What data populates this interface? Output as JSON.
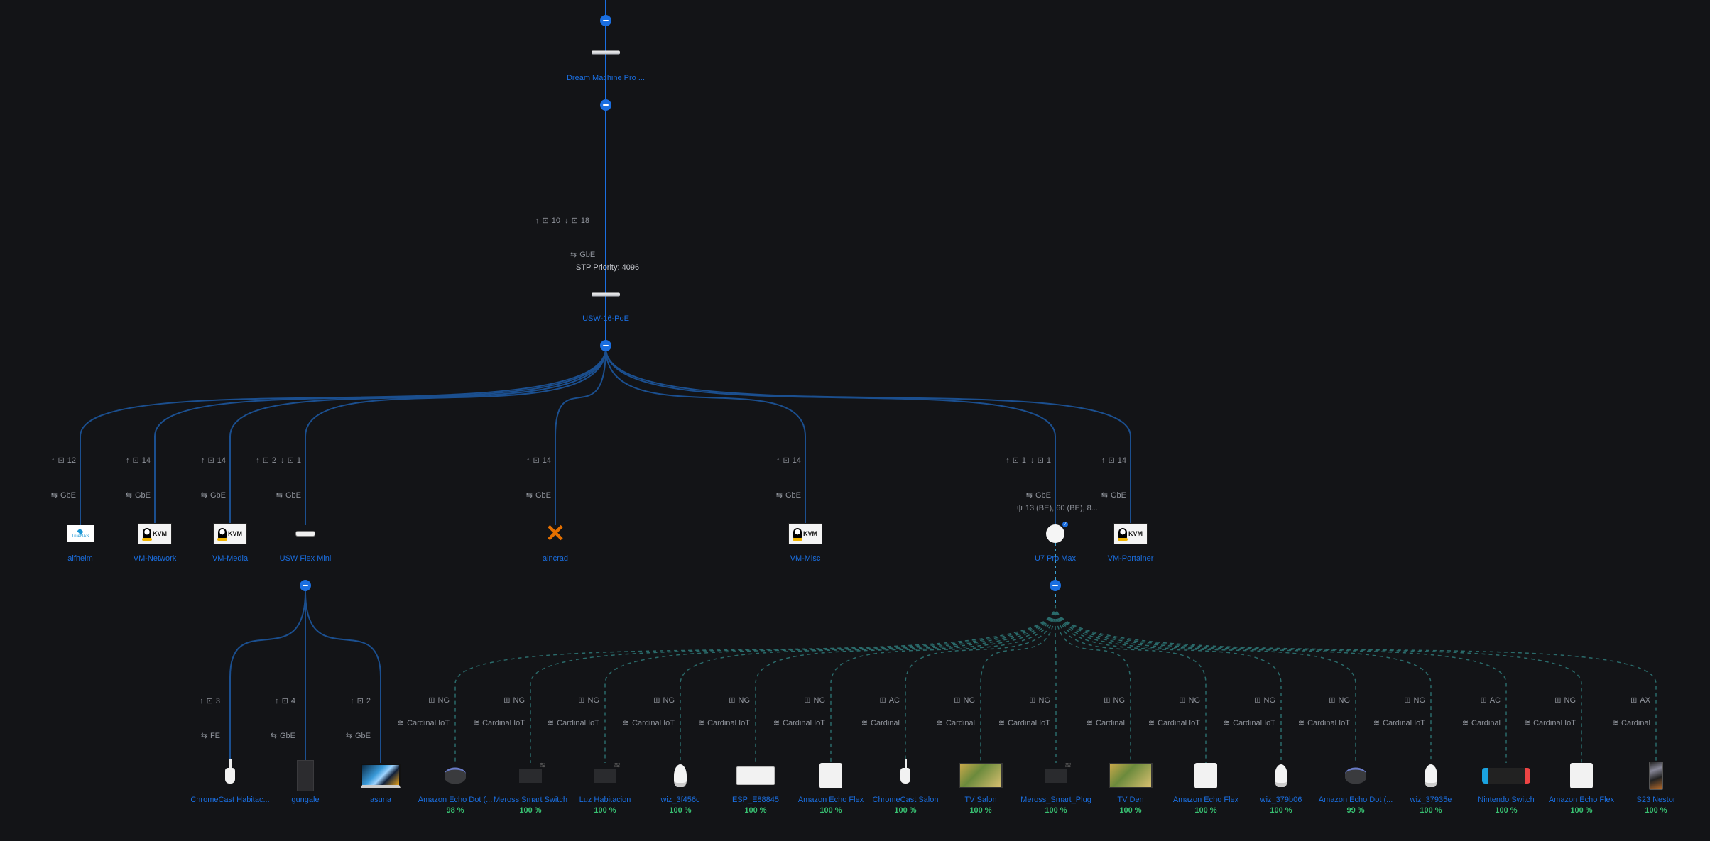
{
  "colors": {
    "background": "#131417",
    "link_blue": "#1a6ee0",
    "wired_line": "#1b4f8f",
    "wireless_dash": "#2a6a6a",
    "meta_text": "#8f939b",
    "signal_green": "#38c172"
  },
  "gateway": {
    "name": "Dream Machine Pro ...",
    "icon": "rack-gateway-icon"
  },
  "core_switch": {
    "name": "USW-16-PoE",
    "icon": "rack-switch-icon",
    "uplink_port_up": "10",
    "uplink_port_down": "18",
    "link_speed": "GbE",
    "stp_priority": "STP Priority: 4096"
  },
  "tier1": [
    {
      "name": "alfheim",
      "icon": "truenas-icon",
      "port_up": "12",
      "port_down": null,
      "speed": "GbE"
    },
    {
      "name": "VM-Network",
      "icon": "kvm-icon",
      "port_up": "14",
      "port_down": null,
      "speed": "GbE"
    },
    {
      "name": "VM-Media",
      "icon": "kvm-icon",
      "port_up": "14",
      "port_down": null,
      "speed": "GbE"
    },
    {
      "name": "USW Flex Mini",
      "icon": "flex-mini-switch-icon",
      "port_up": "2",
      "port_down": "1",
      "speed": "GbE"
    },
    {
      "name": "aincrad",
      "icon": "proxmox-icon",
      "port_up": "14",
      "port_down": null,
      "speed": "GbE"
    },
    {
      "name": "VM-Misc",
      "icon": "kvm-icon",
      "port_up": "14",
      "port_down": null,
      "speed": "GbE"
    },
    {
      "name": "U7 Pro Max",
      "icon": "access-point-icon",
      "port_up": "1",
      "port_down": "1",
      "speed": "GbE",
      "channels": "13 (BE), 60 (BE), 8...",
      "badge": "7"
    },
    {
      "name": "VM-Portainer",
      "icon": "kvm-icon",
      "port_up": "14",
      "port_down": null,
      "speed": "GbE"
    }
  ],
  "flex_clients": [
    {
      "name": "ChromeCast Habitac...",
      "icon": "chromecast-icon",
      "port_up": "3",
      "speed": "FE"
    },
    {
      "name": "gungale",
      "icon": "tower-pc-icon",
      "port_up": "4",
      "speed": "GbE"
    },
    {
      "name": "asuna",
      "icon": "laptop-icon",
      "port_up": "2",
      "speed": "GbE"
    }
  ],
  "wifi_clients": [
    {
      "name": "Amazon Echo Dot (...",
      "icon": "echo-dot-icon",
      "standard": "NG",
      "ssid": "Cardinal IoT",
      "signal": "98 %"
    },
    {
      "name": "Meross Smart Switch",
      "icon": "smart-plug-icon",
      "standard": "NG",
      "ssid": "Cardinal IoT",
      "signal": "100 %"
    },
    {
      "name": "Luz Habitacion",
      "icon": "smart-plug-icon",
      "standard": "NG",
      "ssid": "Cardinal IoT",
      "signal": "100 %"
    },
    {
      "name": "wiz_3f456c",
      "icon": "bulb-icon",
      "standard": "NG",
      "ssid": "Cardinal IoT",
      "signal": "100 %"
    },
    {
      "name": "ESP_E88845",
      "icon": "power-strip-icon",
      "standard": "NG",
      "ssid": "Cardinal IoT",
      "signal": "100 %"
    },
    {
      "name": "Amazon Echo Flex",
      "icon": "echo-flex-icon",
      "standard": "NG",
      "ssid": "Cardinal IoT",
      "signal": "100 %"
    },
    {
      "name": "ChromeCast Salon",
      "icon": "chromecast-icon",
      "standard": "AC",
      "ssid": "Cardinal",
      "signal": "100 %"
    },
    {
      "name": "TV Salon",
      "icon": "tv-icon",
      "standard": "NG",
      "ssid": "Cardinal",
      "signal": "100 %"
    },
    {
      "name": "Meross_Smart_Plug",
      "icon": "smart-plug-icon",
      "standard": "NG",
      "ssid": "Cardinal IoT",
      "signal": "100 %"
    },
    {
      "name": "TV Den",
      "icon": "tv-icon",
      "standard": "NG",
      "ssid": "Cardinal",
      "signal": "100 %"
    },
    {
      "name": "Amazon Echo Flex",
      "icon": "echo-flex-icon",
      "standard": "NG",
      "ssid": "Cardinal IoT",
      "signal": "100 %"
    },
    {
      "name": "wiz_379b06",
      "icon": "bulb-icon",
      "standard": "NG",
      "ssid": "Cardinal IoT",
      "signal": "100 %"
    },
    {
      "name": "Amazon Echo Dot (...",
      "icon": "echo-dot-icon",
      "standard": "NG",
      "ssid": "Cardinal IoT",
      "signal": "99 %"
    },
    {
      "name": "wiz_37935e",
      "icon": "bulb-icon",
      "standard": "NG",
      "ssid": "Cardinal IoT",
      "signal": "100 %"
    },
    {
      "name": "Nintendo Switch",
      "icon": "game-console-icon",
      "standard": "AC",
      "ssid": "Cardinal",
      "signal": "100 %"
    },
    {
      "name": "Amazon Echo Flex",
      "icon": "echo-flex-icon",
      "standard": "NG",
      "ssid": "Cardinal IoT",
      "signal": "100 %"
    },
    {
      "name": "S23 Nestor",
      "icon": "phone-icon",
      "standard": "AX",
      "ssid": "Cardinal",
      "signal": "100 %"
    }
  ],
  "glyphs": {
    "up": "↑",
    "down": "↓",
    "port": "⊡",
    "speed": "⇆",
    "radio": "⊞",
    "wifi": "≋",
    "antenna": "ψ"
  }
}
